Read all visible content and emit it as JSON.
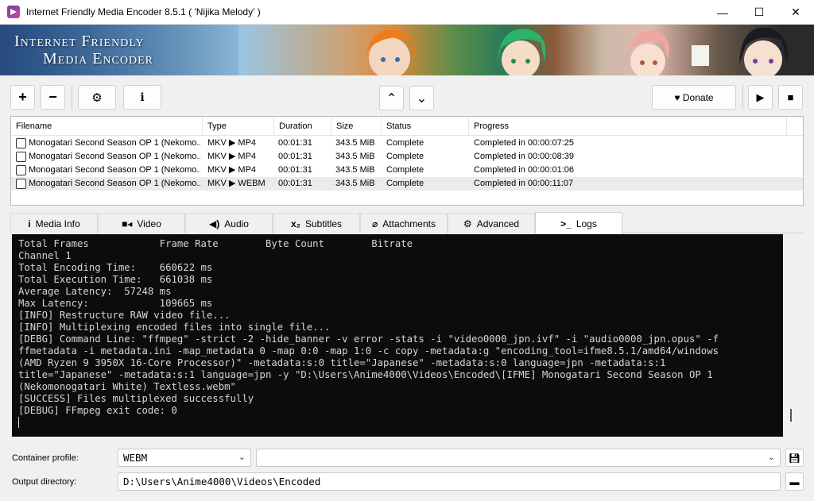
{
  "window": {
    "title": "Internet Friendly Media Encoder 8.5.1 ( 'Nijika Melody' )",
    "controls": {
      "minimize": "—",
      "maximize": "☐",
      "close": "✕"
    }
  },
  "banner": {
    "line1": "Internet Friendly",
    "line2": "Media Encoder"
  },
  "toolbar": {
    "add": "+",
    "remove": "−",
    "settings_icon": "⚙",
    "info_icon": "ℹ",
    "up_icon": "⌃",
    "down_icon": "⌄",
    "donate": "♥ Donate",
    "play_icon": "▶",
    "stop_icon": "■"
  },
  "filelist": {
    "columns": [
      "Filename",
      "Type",
      "Duration",
      "Size",
      "Status",
      "Progress"
    ],
    "rows": [
      {
        "filename": "Monogatari Second Season OP 1 (Nekomo...",
        "type": "MKV ▶ MP4",
        "duration": "00:01:31",
        "size": "343.5 MiB",
        "status": "Complete",
        "progress": "Completed in 00:00:07:25"
      },
      {
        "filename": "Monogatari Second Season OP 1 (Nekomo...",
        "type": "MKV ▶ MP4",
        "duration": "00:01:31",
        "size": "343.5 MiB",
        "status": "Complete",
        "progress": "Completed in 00:00:08:39"
      },
      {
        "filename": "Monogatari Second Season OP 1 (Nekomo...",
        "type": "MKV ▶ MP4",
        "duration": "00:01:31",
        "size": "343.5 MiB",
        "status": "Complete",
        "progress": "Completed in 00:00:01:06"
      },
      {
        "filename": "Monogatari Second Season OP 1 (Nekomo...",
        "type": "MKV ▶ WEBM",
        "duration": "00:01:31",
        "size": "343.5 MiB",
        "status": "Complete",
        "progress": "Completed in 00:00:11:07"
      }
    ]
  },
  "tabs": [
    {
      "icon": "i",
      "label": "Media Info"
    },
    {
      "icon": "■◂",
      "label": "Video"
    },
    {
      "icon": "◀)",
      "label": "Audio"
    },
    {
      "icon": "x₂",
      "label": "Subtitles"
    },
    {
      "icon": "⌀",
      "label": "Attachments"
    },
    {
      "icon": "⚙",
      "label": "Advanced"
    },
    {
      "icon": ">_",
      "label": "Logs"
    }
  ],
  "logs": {
    "lines": [
      "Total Frames            Frame Rate        Byte Count        Bitrate",
      "Channel 1",
      "Total Encoding Time:    660622 ms",
      "Total Execution Time:   661038 ms",
      "Average Latency:  57248 ms",
      "Max Latency:            109665 ms",
      "[INFO] Restructure RAW video file...",
      "[INFO] Multiplexing encoded files into single file...",
      "[DEBG] Command Line: \"ffmpeg\" -strict -2 -hide_banner -v error -stats -i \"video0000_jpn.ivf\" -i \"audio0000_jpn.opus\" -f",
      "ffmetadata -i metadata.ini -map_metadata 0 -map 0:0 -map 1:0 -c copy -metadata:g \"encoding_tool=ifme8.5.1/amd64/windows",
      "(AMD Ryzen 9 3950X 16-Core Processor)\" -metadata:s:0 title=\"Japanese\" -metadata:s:0 language=jpn -metadata:s:1",
      "title=\"Japanese\" -metadata:s:1 language=jpn -y \"D:\\Users\\Anime4000\\Videos\\Encoded\\[IFME] Monogatari Second Season OP 1",
      "(Nekomonogatari White) Textless.webm\"",
      "[SUCCESS] Files multiplexed successfully",
      "[DEBUG] FFmpeg exit code: 0"
    ]
  },
  "bottom": {
    "container_label": "Container profile:",
    "container_value": "WEBM",
    "profile_value": "",
    "output_label": "Output directory:",
    "output_value": "D:\\Users\\Anime4000\\Videos\\Encoded"
  }
}
